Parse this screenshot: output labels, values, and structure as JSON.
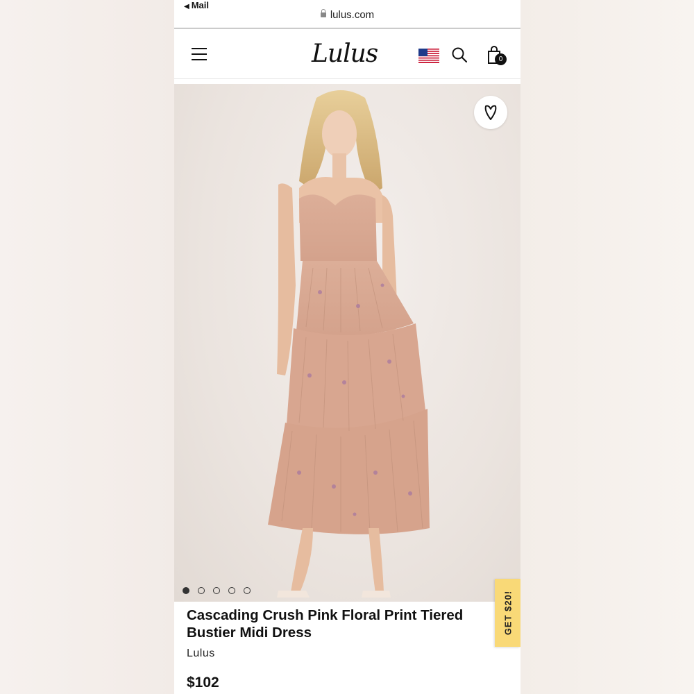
{
  "browser": {
    "back_label": "Mail",
    "url": "lulus.com"
  },
  "header": {
    "logo_text": "Lulus",
    "cart_count": "0",
    "icons": [
      "menu-icon",
      "us-flag-icon",
      "search-icon",
      "shopping-bag-icon"
    ]
  },
  "gallery": {
    "image_count": 5,
    "active_index": 0,
    "wishlist_icon": "heart-icon"
  },
  "promo": {
    "label": "GET $20!",
    "color": "#f9d977"
  },
  "product": {
    "title": "Cascading Crush Pink Floral Print Tiered Bustier Midi Dress",
    "brand": "Lulus",
    "price": "$102"
  }
}
